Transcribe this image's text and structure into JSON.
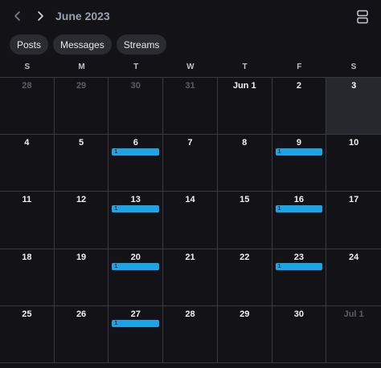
{
  "header": {
    "month_title": "June 2023",
    "prev_icon": "chevron-left-icon",
    "next_icon": "chevron-right-icon",
    "view_icon": "calendar-view-toggle-icon"
  },
  "filters": [
    "Posts",
    "Messages",
    "Streams"
  ],
  "weekdays": [
    "S",
    "M",
    "T",
    "W",
    "T",
    "F",
    "S"
  ],
  "colors": {
    "background": "#131317",
    "event": "#1ba4e6",
    "chip": "#2b2c31",
    "today": "#27282d"
  },
  "days": [
    {
      "label": "28",
      "other": true
    },
    {
      "label": "29",
      "other": true
    },
    {
      "label": "30",
      "other": true
    },
    {
      "label": "31",
      "other": true
    },
    {
      "label": "Jun 1"
    },
    {
      "label": "2"
    },
    {
      "label": "3",
      "today": true
    },
    {
      "label": "4"
    },
    {
      "label": "5"
    },
    {
      "label": "6",
      "event": "1"
    },
    {
      "label": "7"
    },
    {
      "label": "8"
    },
    {
      "label": "9",
      "event": "1"
    },
    {
      "label": "10"
    },
    {
      "label": "11"
    },
    {
      "label": "12"
    },
    {
      "label": "13",
      "event": "1"
    },
    {
      "label": "14"
    },
    {
      "label": "15"
    },
    {
      "label": "16",
      "event": "1"
    },
    {
      "label": "17"
    },
    {
      "label": "18"
    },
    {
      "label": "19"
    },
    {
      "label": "20",
      "event": "1"
    },
    {
      "label": "21"
    },
    {
      "label": "22"
    },
    {
      "label": "23",
      "event": "1"
    },
    {
      "label": "24"
    },
    {
      "label": "25"
    },
    {
      "label": "26"
    },
    {
      "label": "27",
      "event": "1"
    },
    {
      "label": "28"
    },
    {
      "label": "29"
    },
    {
      "label": "30"
    },
    {
      "label": "Jul 1",
      "other": true
    }
  ]
}
